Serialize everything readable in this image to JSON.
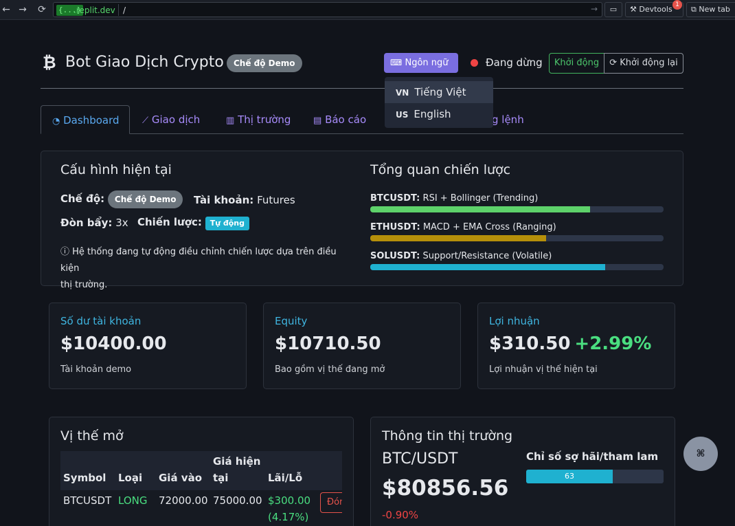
{
  "browser": {
    "url_badge": "{...}",
    "url_host": ".replit.dev",
    "url_path": "/",
    "devtools_label": "Devtools",
    "devtools_badge": "1",
    "new_tab_label": "New tab"
  },
  "header": {
    "title": "Bot Giao Dịch Crypto",
    "mode_badge": "Chế độ Demo",
    "language_button": "Ngôn ngữ",
    "status_text": "Đang dừng",
    "start_button": "Khởi động",
    "restart_button": "Khởi động lại"
  },
  "language_menu": {
    "items": [
      {
        "flag": "VN",
        "label": "Tiếng Việt"
      },
      {
        "flag": "US",
        "label": "English"
      }
    ]
  },
  "tabs": [
    {
      "label": "Dashboard"
    },
    {
      "label": "Giao dịch"
    },
    {
      "label": "Thị trường"
    },
    {
      "label": "Báo cáo"
    },
    {
      "label": "g lệnh"
    }
  ],
  "config": {
    "title": "Cấu hình hiện tại",
    "mode_label": "Chế độ:",
    "mode_value": "Chế độ Demo",
    "account_label": "Tài khoản:",
    "account_value": "Futures",
    "leverage_label": "Đòn bẩy:",
    "leverage_value": "3x",
    "strategy_label": "Chiến lược:",
    "strategy_value": "Tự động",
    "note_line1": "Hệ thống đang tự động điều chỉnh chiến lược dựa trên điều kiện",
    "note_line2": "thị trường."
  },
  "strategy": {
    "title": "Tổng quan chiến lược",
    "items": [
      {
        "symbol": "BTCUSDT:",
        "desc": "RSI + Bollinger (Trending)",
        "progress": 0.75,
        "color": "#5dd26a"
      },
      {
        "symbol": "ETHUSDT:",
        "desc": "MACD + EMA Cross (Ranging)",
        "progress": 0.6,
        "color": "#b58f0a"
      },
      {
        "symbol": "SOLUSDT:",
        "desc": "Support/Resistance (Volatile)",
        "progress": 0.8,
        "color": "#1fb1d0"
      }
    ]
  },
  "stats": [
    {
      "label": "Số dư tài khoản",
      "value": "$10400.00",
      "pct": "",
      "sub": "Tài khoản demo"
    },
    {
      "label": "Equity",
      "value": "$10710.50",
      "pct": "",
      "sub": "Bao gồm vị thế đang mở"
    },
    {
      "label": "Lợi nhuận",
      "value": "$310.50",
      "pct": "+2.99%",
      "sub": "Lợi nhuận vị thế hiện tại"
    }
  ],
  "positions": {
    "title": "Vị thế mở",
    "headers": [
      "Symbol",
      "Loại",
      "Giá vào",
      "Giá hiện",
      "tại",
      "Lãi/Lỗ"
    ],
    "rows": [
      {
        "symbol": "BTCUSDT",
        "type": "LONG",
        "entry": "72000.00",
        "current": "75000.00",
        "pnl": "$300.00",
        "pnl_pct": "(4.17%)",
        "action": "Đóng"
      }
    ]
  },
  "market": {
    "title": "Thông tin thị trường",
    "pair": "BTC/USDT",
    "price": "$80856.56",
    "change": "-0.90%",
    "fear_greed_label": "Chỉ số sợ hãi/tham lam",
    "fear_greed_value": "63",
    "fear_greed_progress": 0.63
  },
  "colors": {
    "accent": "#7a6ee0",
    "link": "#a78bfa",
    "active_tab": "#5aa9f0",
    "positive": "#4ade80",
    "negative": "#ef4444"
  }
}
